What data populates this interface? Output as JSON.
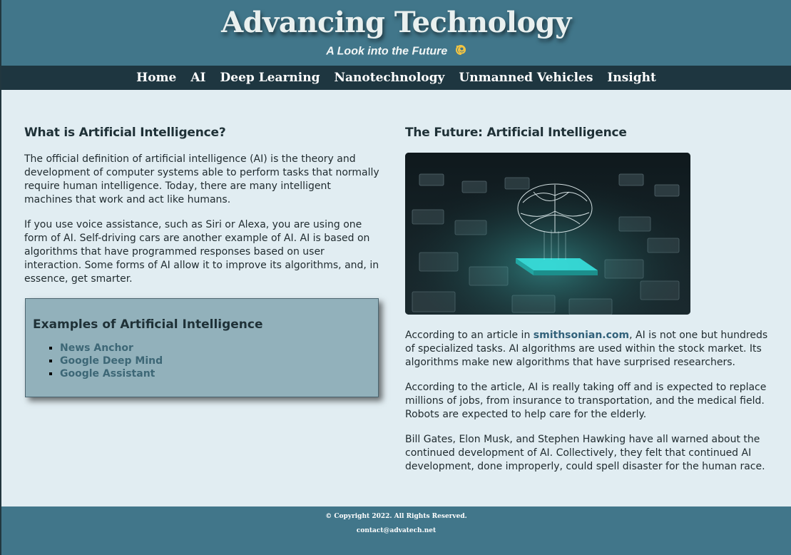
{
  "header": {
    "title": "Advancing Technology",
    "subtitle": "A Look into the Future",
    "subtitle_icon": "dizzy-spiral-icon"
  },
  "nav": {
    "items": [
      {
        "label": "Home"
      },
      {
        "label": "AI"
      },
      {
        "label": "Deep Learning"
      },
      {
        "label": "Nanotechnology"
      },
      {
        "label": "Unmanned Vehicles"
      },
      {
        "label": "Insight"
      }
    ]
  },
  "left": {
    "title": "What is Artificial Intelligence?",
    "paragraphs": [
      "The official definition of artificial intelligence (AI) is the theory and development of computer systems able to perform tasks that normally require human intelligence. Today, there are many intelligent machines that work and act like humans.",
      "If you use voice assistance, such as Siri or Alexa, you are using one form of AI. Self-driving cars are another example of AI. AI is based on algorithms that have programmed responses based on user interaction. Some forms of AI allow it to improve its algorithms, and, in essence, get smarter."
    ],
    "examples": {
      "title": "Examples of Artificial Intelligence",
      "items": [
        "News Anchor",
        "Google Deep Mind",
        "Google Assistant"
      ]
    }
  },
  "right": {
    "title": "The Future: Artificial Intelligence",
    "image_alt": "brain-over-chip-image",
    "p1_before": "According to an article in ",
    "p1_link": "smithsonian.com",
    "p1_after": ", AI is not one but hundreds of specialized tasks. AI algorithms are used within the stock market. Its algorithms make new algorithms that have surprised researchers.",
    "p2": "According to the article, AI is really taking off and is expected to replace millions of jobs, from insurance to transportation, and the medical field. Robots are expected to help care for the elderly.",
    "p3": "Bill Gates, Elon Musk, and Stephen Hawking have all warned about the continued development of AI. Collectively, they felt that continued AI development, done improperly, could spell disaster for the human race."
  },
  "footer": {
    "copyright": "© Copyright 2022. All Rights Reserved.",
    "contact": "contact@advatech.net"
  },
  "colors": {
    "header_bg": "#41768a",
    "nav_bg": "#1e3640",
    "page_bg": "#e1edf2",
    "box_bg": "#92b1bb",
    "link": "#31617a"
  }
}
